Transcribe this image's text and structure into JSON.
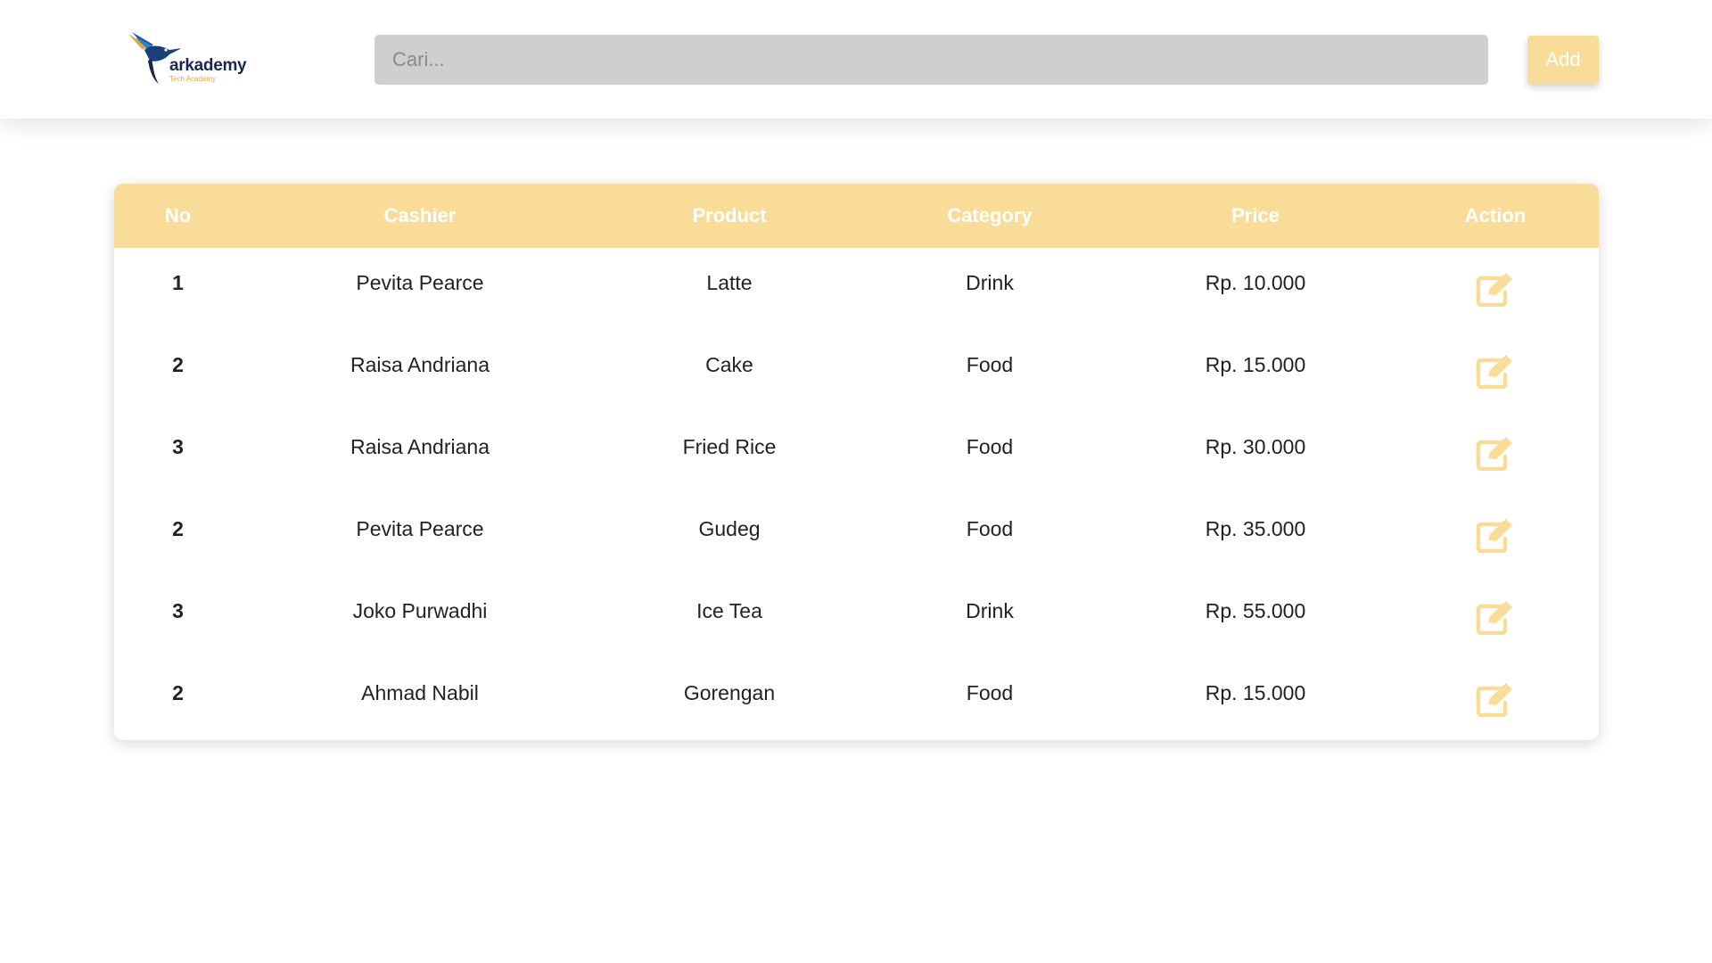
{
  "brand": {
    "name": "arkademy",
    "tagline": "Tech Academy",
    "accent_color": "#f9dc98",
    "dark_color": "#16284f"
  },
  "header": {
    "search_placeholder": "Cari...",
    "search_value": "",
    "add_label": "Add"
  },
  "table": {
    "columns": [
      "No",
      "Cashier",
      "Product",
      "Category",
      "Price",
      "Action"
    ],
    "action_icon": "edit-icon",
    "rows": [
      {
        "no": "1",
        "cashier": "Pevita Pearce",
        "product": "Latte",
        "category": "Drink",
        "price": "Rp. 10.000"
      },
      {
        "no": "2",
        "cashier": "Raisa Andriana",
        "product": "Cake",
        "category": "Food",
        "price": "Rp. 15.000"
      },
      {
        "no": "3",
        "cashier": "Raisa Andriana",
        "product": "Fried Rice",
        "category": "Food",
        "price": "Rp. 30.000"
      },
      {
        "no": "2",
        "cashier": "Pevita Pearce",
        "product": "Gudeg",
        "category": "Food",
        "price": "Rp. 35.000"
      },
      {
        "no": "3",
        "cashier": "Joko Purwadhi",
        "product": "Ice Tea",
        "category": "Drink",
        "price": "Rp. 55.000"
      },
      {
        "no": "2",
        "cashier": "Ahmad Nabil",
        "product": "Gorengan",
        "category": "Food",
        "price": "Rp. 15.000"
      }
    ]
  }
}
